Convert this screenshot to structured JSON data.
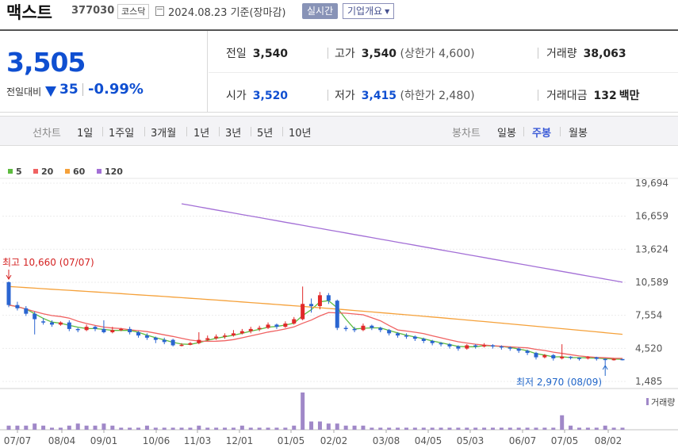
{
  "header": {
    "name": "맥스트",
    "code": "377030",
    "market": "코스닥",
    "as_of": "2024.08.23 기준(장마감)",
    "realtime_label": "실시간",
    "corp_info_label": "기업개요"
  },
  "quote": {
    "price": "3,505",
    "compare_label": "전일대비",
    "change": "35",
    "change_pct": "-0.99%",
    "prev_label": "전일",
    "prev": "3,540",
    "high_label": "고가",
    "high": "3,540",
    "upper_limit": "(상한가 4,600)",
    "volume_label": "거래량",
    "volume": "38,063",
    "open_label": "시가",
    "open": "3,520",
    "low_label": "저가",
    "low": "3,415",
    "lower_limit": "(하한가 2,480)",
    "turnover_label": "거래대금",
    "turnover": "132",
    "turnover_unit": "백만"
  },
  "tabs": {
    "line_group": "선차트",
    "line_items": [
      "1일",
      "1주일",
      "3개월",
      "1년",
      "3년",
      "5년",
      "10년"
    ],
    "candle_group": "봉차트",
    "candle_items": [
      "일봉",
      "주봉",
      "월봉"
    ],
    "candle_selected": "주봉"
  },
  "chart_data": {
    "type": "line",
    "legend": [
      "5",
      "20",
      "60",
      "120"
    ],
    "colors": {
      "ma5": "#5dbb3f",
      "ma20": "#f06262",
      "ma60": "#f5a13a",
      "ma120": "#a36fd6",
      "up": "#e12a2a",
      "down": "#2a65d1",
      "volume": "#a088c8",
      "high_note": "#d42222",
      "low_note": "#2166c9"
    },
    "y_ticks": [
      "19,694",
      "16,659",
      "13,624",
      "10,589",
      "7,554",
      "4,520",
      "1,485"
    ],
    "y_range": [
      1485,
      19694
    ],
    "x_ticks": [
      "07/07",
      "08/04",
      "09/01",
      "10/06",
      "11/03",
      "12/01",
      "01/05",
      "02/02",
      "03/08",
      "04/05",
      "05/03",
      "06/07",
      "07/05",
      "08/02"
    ],
    "high_note": "최고 10,660 (07/07)",
    "low_note": "최저 2,970 (08/09)",
    "volume_label": "거래량",
    "candles": [
      [
        10600,
        8500,
        10660,
        8300
      ],
      [
        8500,
        8200,
        8800,
        8000
      ],
      [
        8200,
        7700,
        8400,
        7500
      ],
      [
        7700,
        7200,
        7900,
        5800
      ],
      [
        7000,
        6900,
        7300,
        6700
      ],
      [
        6900,
        6700,
        7100,
        6500
      ],
      [
        6700,
        6900,
        7000,
        6600
      ],
      [
        6900,
        6300,
        7100,
        6100
      ],
      [
        6300,
        6200,
        6400,
        6000
      ],
      [
        6200,
        6500,
        6700,
        6100
      ],
      [
        6500,
        6300,
        6600,
        6100
      ],
      [
        6300,
        6000,
        7100,
        5900
      ],
      [
        6000,
        6200,
        6500,
        5900
      ],
      [
        6200,
        6300,
        6400,
        6100
      ],
      [
        6300,
        6000,
        6500,
        5800
      ],
      [
        6000,
        5700,
        6100,
        5500
      ],
      [
        5700,
        5500,
        5900,
        5300
      ],
      [
        5500,
        5300,
        5600,
        5000
      ],
      [
        5300,
        5100,
        5500,
        4900
      ],
      [
        5300,
        4800,
        5400,
        4700
      ],
      [
        4800,
        4850,
        5000,
        4700
      ],
      [
        4850,
        5000,
        5100,
        4800
      ],
      [
        5000,
        5300,
        6000,
        4900
      ],
      [
        5300,
        5450,
        5700,
        5200
      ],
      [
        5450,
        5600,
        5800,
        5300
      ],
      [
        5600,
        5700,
        5900,
        5400
      ],
      [
        5700,
        5900,
        6200,
        5600
      ],
      [
        5900,
        6100,
        6300,
        5800
      ],
      [
        6100,
        6300,
        6500,
        5900
      ],
      [
        6300,
        6400,
        6600,
        6100
      ],
      [
        6400,
        6700,
        6900,
        6300
      ],
      [
        6700,
        6500,
        6800,
        6300
      ],
      [
        6500,
        6800,
        7000,
        6400
      ],
      [
        6800,
        7200,
        7400,
        6700
      ],
      [
        7200,
        8600,
        10200,
        7100
      ],
      [
        8600,
        8400,
        9100,
        7800
      ],
      [
        8400,
        9400,
        9700,
        8100
      ],
      [
        9400,
        8900,
        9600,
        8600
      ],
      [
        8900,
        6400,
        9000,
        6200
      ],
      [
        6400,
        6300,
        6600,
        6100
      ],
      [
        6300,
        6200,
        6500,
        6000
      ],
      [
        6200,
        6600,
        6800,
        6100
      ],
      [
        6600,
        6400,
        6700,
        6200
      ],
      [
        6400,
        6200,
        6500,
        6000
      ],
      [
        6200,
        5900,
        6300,
        5700
      ],
      [
        5900,
        5700,
        6000,
        5500
      ],
      [
        5700,
        5600,
        5900,
        5400
      ],
      [
        5600,
        5400,
        5700,
        5200
      ],
      [
        5400,
        5200,
        5500,
        5000
      ],
      [
        5200,
        5000,
        5300,
        4800
      ],
      [
        5000,
        4900,
        5100,
        4700
      ],
      [
        4900,
        4700,
        5000,
        4500
      ],
      [
        4700,
        4500,
        4800,
        4300
      ],
      [
        4500,
        4800,
        4900,
        4400
      ],
      [
        4800,
        4700,
        4900,
        4500
      ],
      [
        4700,
        4800,
        5000,
        4600
      ],
      [
        4800,
        4700,
        4900,
        4500
      ],
      [
        4700,
        4600,
        4800,
        4400
      ],
      [
        4600,
        4500,
        4700,
        4300
      ],
      [
        4500,
        4300,
        4600,
        4100
      ],
      [
        4300,
        4100,
        4400,
        3900
      ],
      [
        4100,
        3700,
        4200,
        3500
      ],
      [
        3700,
        3900,
        4000,
        3600
      ],
      [
        3900,
        3600,
        4000,
        3400
      ],
      [
        3600,
        3750,
        4900,
        3500
      ],
      [
        3750,
        3650,
        3800,
        3500
      ],
      [
        3650,
        3600,
        3700,
        3400
      ],
      [
        3600,
        3700,
        3800,
        3500
      ],
      [
        3700,
        3550,
        3750,
        3400
      ],
      [
        3550,
        3500,
        3600,
        2970
      ],
      [
        3500,
        3540,
        3600,
        3400
      ],
      [
        3540,
        3505,
        3540,
        3415
      ]
    ],
    "volume": [
      2,
      2,
      2,
      3,
      2,
      1,
      1,
      2,
      3,
      2,
      2,
      3,
      2,
      1,
      1,
      1,
      2,
      1,
      1,
      1,
      1,
      1,
      2,
      1,
      1,
      1,
      1,
      2,
      1,
      1,
      1,
      1,
      1,
      2,
      18,
      4,
      4,
      3,
      3,
      2,
      2,
      2,
      1,
      1,
      1,
      1,
      1,
      1,
      1,
      1,
      1,
      1,
      1,
      1,
      1,
      1,
      1,
      1,
      1,
      1,
      1,
      1,
      1,
      1,
      7,
      2,
      1,
      1,
      1,
      2,
      1,
      1
    ]
  }
}
